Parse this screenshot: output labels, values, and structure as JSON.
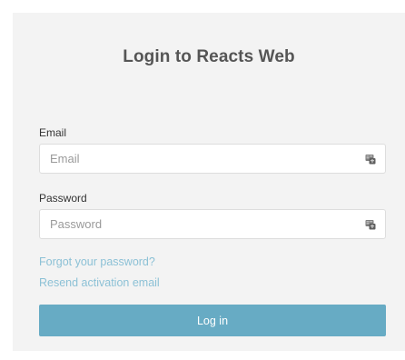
{
  "page": {
    "title": "Login to Reacts Web"
  },
  "form": {
    "email": {
      "label": "Email",
      "value": "",
      "placeholder": "Email",
      "icon": "autofill-card-icon"
    },
    "password": {
      "label": "Password",
      "value": "",
      "placeholder": "Password",
      "icon": "autofill-card-icon"
    },
    "forgot_link": "Forgot your password?",
    "resend_link": "Resend activation email",
    "login_button": "Log in"
  },
  "colors": {
    "panel_background": "#f3f3f3",
    "link": "#8cc1d6",
    "button": "#67abc4",
    "title_text": "#555555"
  }
}
